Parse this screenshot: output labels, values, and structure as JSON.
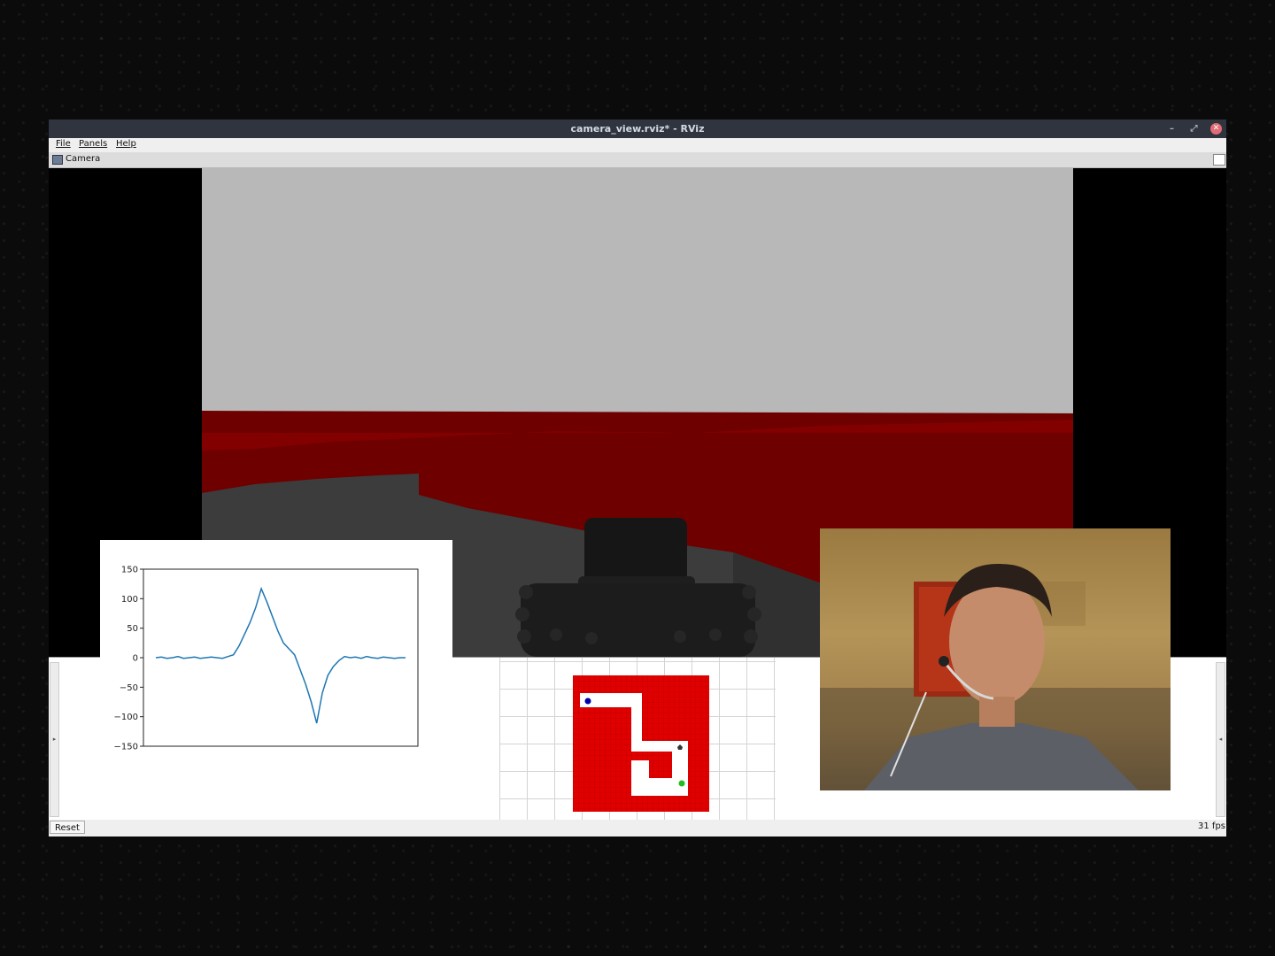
{
  "window": {
    "title": "camera_view.rviz* - RViz",
    "controls": {
      "minimize": "–",
      "maximize": "⤢",
      "close": "✕"
    }
  },
  "menu": {
    "items": [
      {
        "label": "File"
      },
      {
        "label": "Panels"
      },
      {
        "label": "Help"
      }
    ]
  },
  "panel": {
    "title": "Camera",
    "icon": "camera-icon"
  },
  "status": {
    "reset_label": "Reset",
    "fps": "31 fps"
  },
  "colors": {
    "wall_red": "#7a0000",
    "floor_gray": "#3a3a3a",
    "sky_gray": "#b7b7b7",
    "plot_line": "#1f77b4",
    "map_red": "#e00000",
    "robot_marker": "#0000aa",
    "goal_marker": "#22bb22"
  },
  "chart_data": {
    "type": "line",
    "title": "",
    "xlabel": "",
    "ylabel": "",
    "ylim": [
      -150,
      150
    ],
    "yticks": [
      150,
      100,
      50,
      0,
      -50,
      -100,
      -150
    ],
    "grid": false,
    "series": [
      {
        "values": [
          0,
          1,
          -1,
          0,
          2,
          -1,
          0,
          1,
          -1,
          0,
          1,
          0,
          -1,
          2,
          5,
          20,
          40,
          60,
          85,
          117,
          95,
          70,
          45,
          25,
          15,
          5,
          -20,
          -45,
          -75,
          -111,
          -60,
          -30,
          -15,
          -5,
          2,
          0,
          1,
          -1,
          2,
          0,
          -1,
          1,
          0,
          -1,
          0,
          0
        ]
      }
    ]
  },
  "map": {
    "description_icon": "occupancy-grid",
    "robot_icon": "robot-marker-icon",
    "goal_icon": "goal-marker-icon"
  }
}
